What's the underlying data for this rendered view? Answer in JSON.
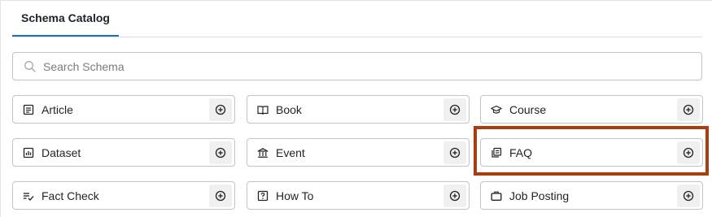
{
  "tabs": [
    {
      "label": "Schema Catalog",
      "active": true
    }
  ],
  "search": {
    "placeholder": "Search Schema",
    "value": ""
  },
  "schemas": [
    {
      "label": "Article",
      "icon": "article-icon"
    },
    {
      "label": "Book",
      "icon": "book-icon"
    },
    {
      "label": "Course",
      "icon": "course-icon"
    },
    {
      "label": "Dataset",
      "icon": "dataset-icon"
    },
    {
      "label": "Event",
      "icon": "event-icon"
    },
    {
      "label": "FAQ",
      "icon": "faq-icon"
    },
    {
      "label": "Fact Check",
      "icon": "fact-check-icon"
    },
    {
      "label": "How To",
      "icon": "how-to-icon"
    },
    {
      "label": "Job Posting",
      "icon": "job-posting-icon"
    }
  ],
  "colors": {
    "accent": "#2271b1",
    "highlight": "#a83d12"
  }
}
